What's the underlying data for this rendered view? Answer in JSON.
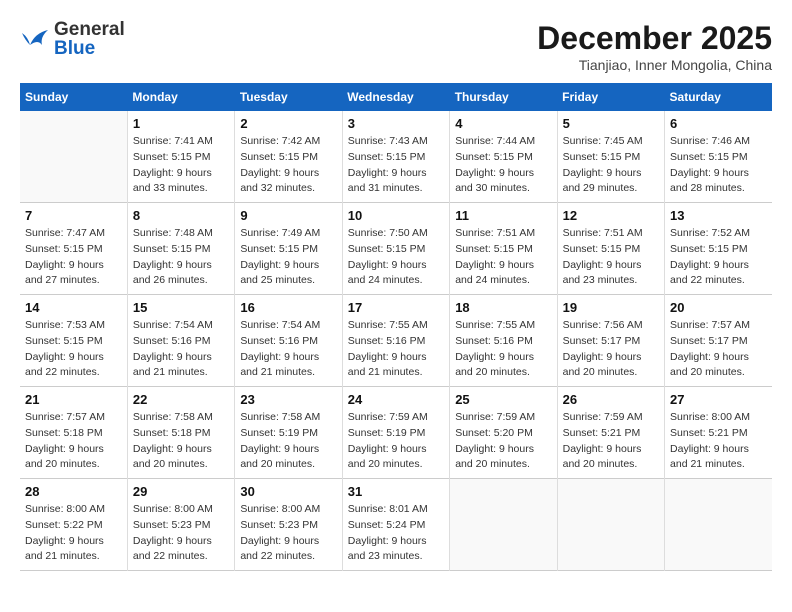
{
  "header": {
    "logo_general": "General",
    "logo_blue": "Blue",
    "month_title": "December 2025",
    "location": "Tianjiao, Inner Mongolia, China"
  },
  "weekdays": [
    "Sunday",
    "Monday",
    "Tuesday",
    "Wednesday",
    "Thursday",
    "Friday",
    "Saturday"
  ],
  "weeks": [
    [
      {
        "day": "",
        "info": ""
      },
      {
        "day": "1",
        "info": "Sunrise: 7:41 AM\nSunset: 5:15 PM\nDaylight: 9 hours\nand 33 minutes."
      },
      {
        "day": "2",
        "info": "Sunrise: 7:42 AM\nSunset: 5:15 PM\nDaylight: 9 hours\nand 32 minutes."
      },
      {
        "day": "3",
        "info": "Sunrise: 7:43 AM\nSunset: 5:15 PM\nDaylight: 9 hours\nand 31 minutes."
      },
      {
        "day": "4",
        "info": "Sunrise: 7:44 AM\nSunset: 5:15 PM\nDaylight: 9 hours\nand 30 minutes."
      },
      {
        "day": "5",
        "info": "Sunrise: 7:45 AM\nSunset: 5:15 PM\nDaylight: 9 hours\nand 29 minutes."
      },
      {
        "day": "6",
        "info": "Sunrise: 7:46 AM\nSunset: 5:15 PM\nDaylight: 9 hours\nand 28 minutes."
      }
    ],
    [
      {
        "day": "7",
        "info": "Sunrise: 7:47 AM\nSunset: 5:15 PM\nDaylight: 9 hours\nand 27 minutes."
      },
      {
        "day": "8",
        "info": "Sunrise: 7:48 AM\nSunset: 5:15 PM\nDaylight: 9 hours\nand 26 minutes."
      },
      {
        "day": "9",
        "info": "Sunrise: 7:49 AM\nSunset: 5:15 PM\nDaylight: 9 hours\nand 25 minutes."
      },
      {
        "day": "10",
        "info": "Sunrise: 7:50 AM\nSunset: 5:15 PM\nDaylight: 9 hours\nand 24 minutes."
      },
      {
        "day": "11",
        "info": "Sunrise: 7:51 AM\nSunset: 5:15 PM\nDaylight: 9 hours\nand 24 minutes."
      },
      {
        "day": "12",
        "info": "Sunrise: 7:51 AM\nSunset: 5:15 PM\nDaylight: 9 hours\nand 23 minutes."
      },
      {
        "day": "13",
        "info": "Sunrise: 7:52 AM\nSunset: 5:15 PM\nDaylight: 9 hours\nand 22 minutes."
      }
    ],
    [
      {
        "day": "14",
        "info": "Sunrise: 7:53 AM\nSunset: 5:15 PM\nDaylight: 9 hours\nand 22 minutes."
      },
      {
        "day": "15",
        "info": "Sunrise: 7:54 AM\nSunset: 5:16 PM\nDaylight: 9 hours\nand 21 minutes."
      },
      {
        "day": "16",
        "info": "Sunrise: 7:54 AM\nSunset: 5:16 PM\nDaylight: 9 hours\nand 21 minutes."
      },
      {
        "day": "17",
        "info": "Sunrise: 7:55 AM\nSunset: 5:16 PM\nDaylight: 9 hours\nand 21 minutes."
      },
      {
        "day": "18",
        "info": "Sunrise: 7:55 AM\nSunset: 5:16 PM\nDaylight: 9 hours\nand 20 minutes."
      },
      {
        "day": "19",
        "info": "Sunrise: 7:56 AM\nSunset: 5:17 PM\nDaylight: 9 hours\nand 20 minutes."
      },
      {
        "day": "20",
        "info": "Sunrise: 7:57 AM\nSunset: 5:17 PM\nDaylight: 9 hours\nand 20 minutes."
      }
    ],
    [
      {
        "day": "21",
        "info": "Sunrise: 7:57 AM\nSunset: 5:18 PM\nDaylight: 9 hours\nand 20 minutes."
      },
      {
        "day": "22",
        "info": "Sunrise: 7:58 AM\nSunset: 5:18 PM\nDaylight: 9 hours\nand 20 minutes."
      },
      {
        "day": "23",
        "info": "Sunrise: 7:58 AM\nSunset: 5:19 PM\nDaylight: 9 hours\nand 20 minutes."
      },
      {
        "day": "24",
        "info": "Sunrise: 7:59 AM\nSunset: 5:19 PM\nDaylight: 9 hours\nand 20 minutes."
      },
      {
        "day": "25",
        "info": "Sunrise: 7:59 AM\nSunset: 5:20 PM\nDaylight: 9 hours\nand 20 minutes."
      },
      {
        "day": "26",
        "info": "Sunrise: 7:59 AM\nSunset: 5:21 PM\nDaylight: 9 hours\nand 20 minutes."
      },
      {
        "day": "27",
        "info": "Sunrise: 8:00 AM\nSunset: 5:21 PM\nDaylight: 9 hours\nand 21 minutes."
      }
    ],
    [
      {
        "day": "28",
        "info": "Sunrise: 8:00 AM\nSunset: 5:22 PM\nDaylight: 9 hours\nand 21 minutes."
      },
      {
        "day": "29",
        "info": "Sunrise: 8:00 AM\nSunset: 5:23 PM\nDaylight: 9 hours\nand 22 minutes."
      },
      {
        "day": "30",
        "info": "Sunrise: 8:00 AM\nSunset: 5:23 PM\nDaylight: 9 hours\nand 22 minutes."
      },
      {
        "day": "31",
        "info": "Sunrise: 8:01 AM\nSunset: 5:24 PM\nDaylight: 9 hours\nand 23 minutes."
      },
      {
        "day": "",
        "info": ""
      },
      {
        "day": "",
        "info": ""
      },
      {
        "day": "",
        "info": ""
      }
    ]
  ]
}
